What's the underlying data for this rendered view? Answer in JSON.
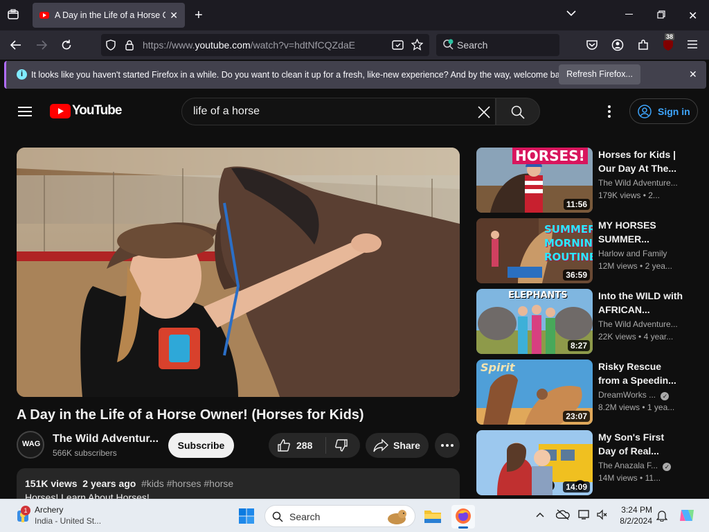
{
  "browser": {
    "tab_title": "A Day in the Life of a Horse Ow",
    "url_prefix": "https://www.",
    "url_host": "youtube.com",
    "url_path": "/watch?v=hdtNfCQZdaE",
    "search_placeholder": "Search",
    "extension_badge": "38",
    "notification_text": "It looks like you haven't started Firefox in a while. Do you want to clean it up for a fresh, like-new experience? And by the way, welcome back!",
    "notification_button": "Refresh Firefox..."
  },
  "youtube": {
    "logo_text": "YouTube",
    "search_query": "life of a horse",
    "sign_in_label": "Sign in",
    "video": {
      "title": "A Day in the Life of a Horse Owner! (Horses for Kids)",
      "channel": "The Wild Adventur...",
      "subscribers": "566K subscribers",
      "subscribe_label": "Subscribe",
      "likes": "288",
      "share_label": "Share",
      "views": "151K views",
      "age": "2 years ago",
      "tags": "#kids #horses #horse",
      "description_line": "Horses!  Learn About Horses!",
      "avatar_text": "WAG"
    },
    "recommendations": [
      {
        "title": "Horses for Kids | Our Day At The...",
        "channel": "The Wild Adventure...",
        "views": "179K views",
        "age": "2...",
        "duration": "11:56",
        "thumb_text": "HORSES!",
        "verified": false
      },
      {
        "title": "MY HORSES SUMMER...",
        "channel": "Harlow and Family",
        "views": "12M views",
        "age": "2 yea...",
        "duration": "36:59",
        "thumb_text": "SUMMER MORNING ROUTINE",
        "verified": false
      },
      {
        "title": "Into the WILD with AFRICAN...",
        "channel": "The Wild Adventure...",
        "views": "22K views",
        "age": "4 year...",
        "duration": "8:27",
        "thumb_text": "ELEPHANTS",
        "verified": false
      },
      {
        "title": "Risky Rescue from a Speedin...",
        "channel": "DreamWorks ...",
        "views": "8.2M views",
        "age": "1 yea...",
        "duration": "23:07",
        "thumb_text": "Spirit",
        "verified": true
      },
      {
        "title": "My Son's First Day of Real...",
        "channel": "The Anazala F...",
        "views": "14M views",
        "age": "11...",
        "duration": "14:09",
        "thumb_text": "",
        "verified": true
      }
    ]
  },
  "taskbar": {
    "weather_name": "Archery",
    "weather_location": "India - United St...",
    "weather_badge": "1",
    "search_label": "Search",
    "time": "3:24 PM",
    "date": "8/2/2024"
  }
}
